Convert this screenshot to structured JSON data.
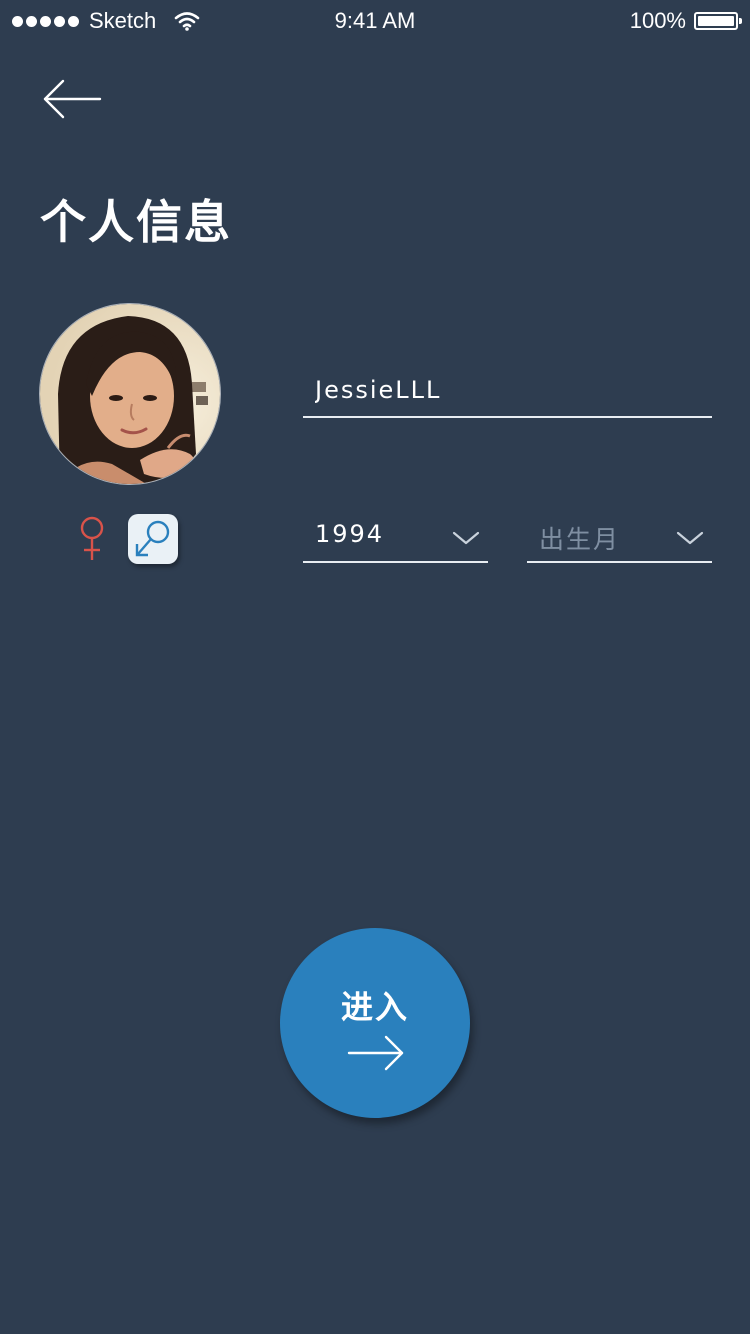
{
  "status_bar": {
    "carrier": "Sketch",
    "time": "9:41 AM",
    "battery": "100%",
    "battery_level": 1.0
  },
  "back": {
    "icon": "back-arrow-icon"
  },
  "page_title": "个人信息",
  "avatar": {
    "icon": "avatar-photo"
  },
  "gender": {
    "female_icon": "female-symbol-icon",
    "male_icon": "male-symbol-icon",
    "selected": "male"
  },
  "form": {
    "name_value": "JessieLLL",
    "year_value": "1994",
    "month_placeholder": "出生月"
  },
  "enter_button": {
    "label": "进入",
    "icon": "arrow-right-icon"
  },
  "colors": {
    "background": "#2e3d50",
    "accent": "#2a80bd",
    "female": "#d9534a",
    "male": "#2a80bd"
  }
}
